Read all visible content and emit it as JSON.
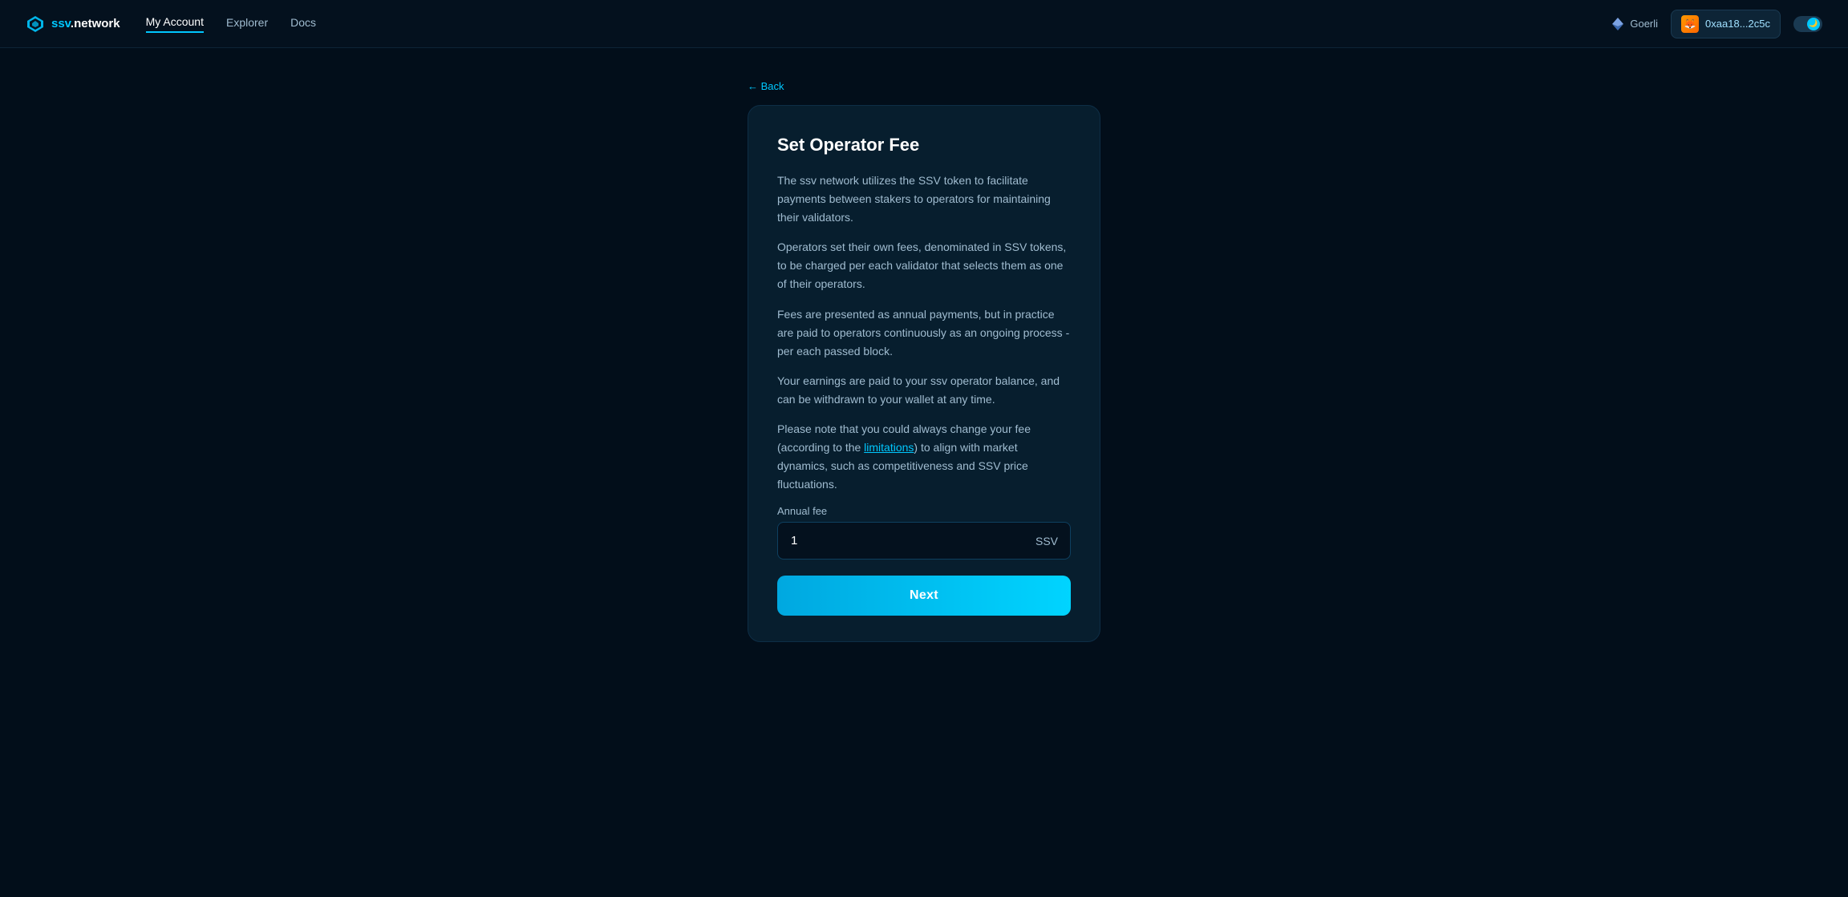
{
  "navbar": {
    "logo_text": "ssv.network",
    "logo_accent": "ssv",
    "links": [
      {
        "label": "My Account",
        "active": true
      },
      {
        "label": "Explorer",
        "active": false
      },
      {
        "label": "Docs",
        "active": false
      }
    ],
    "network": "Goerli",
    "wallet_address": "0xaa18...2c5c"
  },
  "back": {
    "label": "← Back"
  },
  "card": {
    "title": "Set Operator Fee",
    "paragraphs": [
      "The ssv network utilizes the SSV token to facilitate payments between stakers to operators for maintaining their validators.",
      "Operators set their own fees, denominated in SSV tokens, to be charged per each validator that selects them as one of their operators.",
      "Fees are presented as annual payments, but in practice are paid to operators continuously as an ongoing process - per each passed block.",
      "Your earnings are paid to your ssv operator balance, and can be withdrawn to your wallet at any time.",
      "Please note that you could always change your fee (according to the {limitations_link}) to align with market dynamics, such as competitiveness and SSV price fluctuations."
    ],
    "limitations_link_text": "limitations",
    "form": {
      "annual_fee_label": "Annual fee",
      "annual_fee_value": "1",
      "annual_fee_placeholder": "",
      "annual_fee_suffix": "SSV",
      "next_button_label": "Next"
    }
  }
}
